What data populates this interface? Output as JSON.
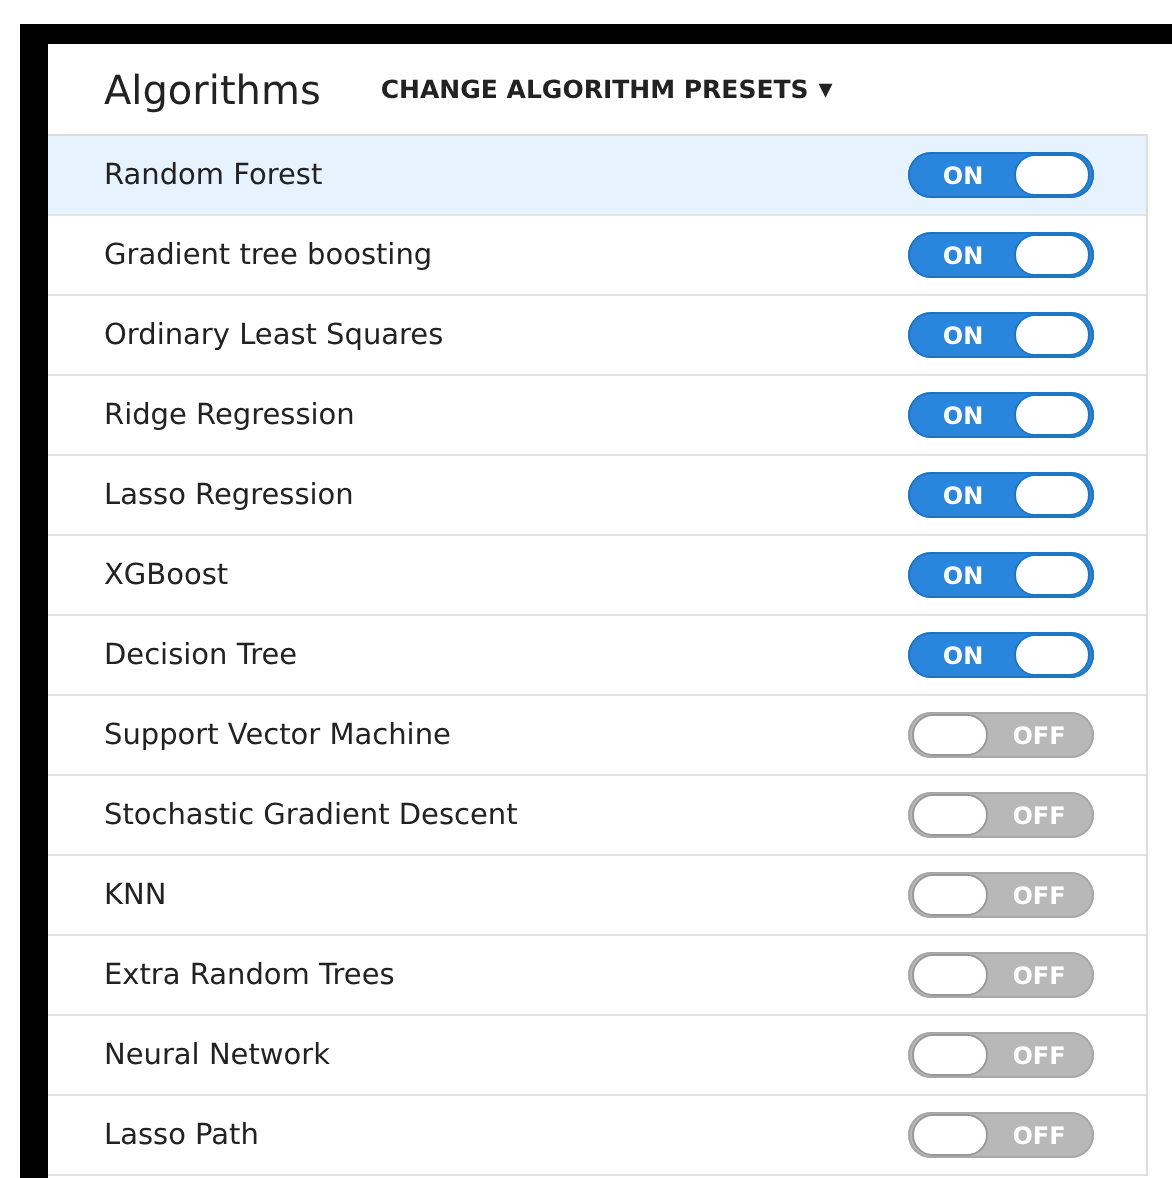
{
  "header": {
    "title": "Algorithms",
    "presets_button": "CHANGE ALGORITHM PRESETS",
    "caret": "▾"
  },
  "algorithms": [
    {
      "name": "Random Forest",
      "on": true,
      "selected": true,
      "toggle_label": "ON"
    },
    {
      "name": "Gradient tree boosting",
      "on": true,
      "selected": false,
      "toggle_label": "ON"
    },
    {
      "name": "Ordinary Least Squares",
      "on": true,
      "selected": false,
      "toggle_label": "ON"
    },
    {
      "name": "Ridge Regression",
      "on": true,
      "selected": false,
      "toggle_label": "ON"
    },
    {
      "name": "Lasso Regression",
      "on": true,
      "selected": false,
      "toggle_label": "ON"
    },
    {
      "name": "XGBoost",
      "on": true,
      "selected": false,
      "toggle_label": "ON"
    },
    {
      "name": "Decision Tree",
      "on": true,
      "selected": false,
      "toggle_label": "ON"
    },
    {
      "name": "Support Vector Machine",
      "on": false,
      "selected": false,
      "toggle_label": "OFF"
    },
    {
      "name": "Stochastic Gradient Descent",
      "on": false,
      "selected": false,
      "toggle_label": "OFF"
    },
    {
      "name": "KNN",
      "on": false,
      "selected": false,
      "toggle_label": "OFF"
    },
    {
      "name": "Extra Random Trees",
      "on": false,
      "selected": false,
      "toggle_label": "OFF"
    },
    {
      "name": "Neural Network",
      "on": false,
      "selected": false,
      "toggle_label": "OFF"
    },
    {
      "name": "Lasso Path",
      "on": false,
      "selected": false,
      "toggle_label": "OFF"
    }
  ]
}
